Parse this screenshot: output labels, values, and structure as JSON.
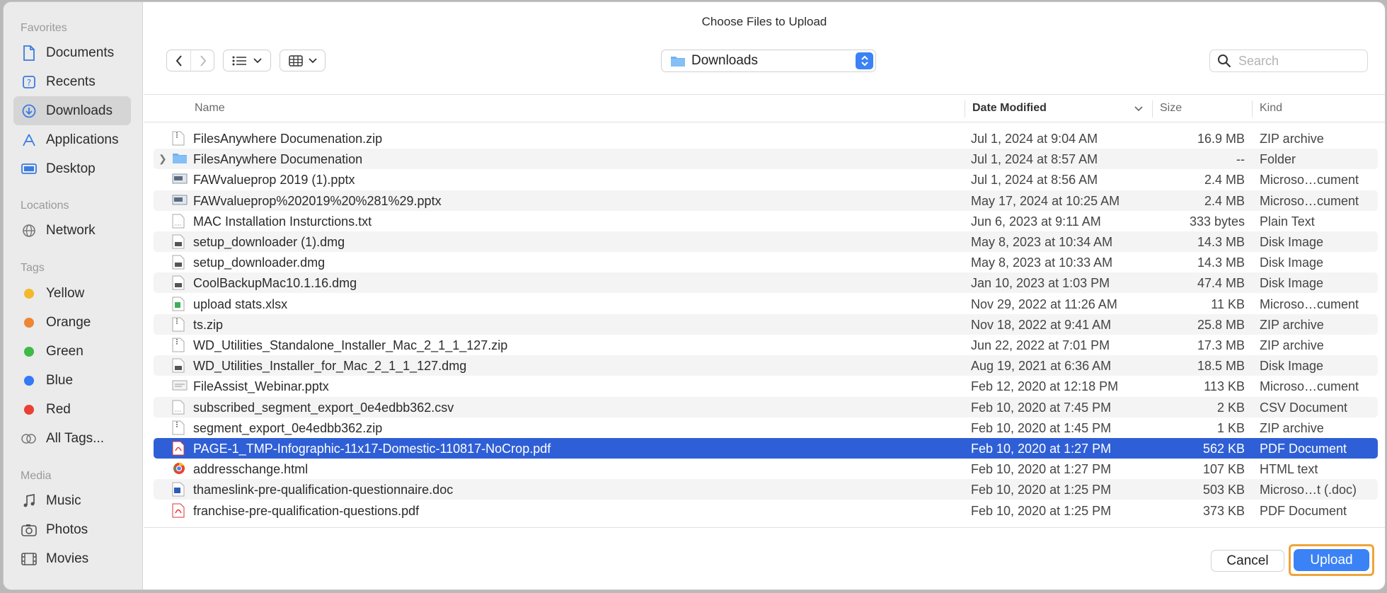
{
  "dialog": {
    "title": "Choose Files to Upload"
  },
  "sidebar": {
    "favorites_label": "Favorites",
    "favorites": [
      {
        "label": "Documents",
        "icon": "document-icon"
      },
      {
        "label": "Recents",
        "icon": "recents-icon"
      },
      {
        "label": "Downloads",
        "icon": "downloads-icon",
        "active": true
      },
      {
        "label": "Applications",
        "icon": "applications-icon"
      },
      {
        "label": "Desktop",
        "icon": "desktop-icon"
      }
    ],
    "locations_label": "Locations",
    "locations": [
      {
        "label": "Network",
        "icon": "network-icon"
      }
    ],
    "tags_label": "Tags",
    "tags": [
      {
        "label": "Yellow",
        "color": "#f2b92c"
      },
      {
        "label": "Orange",
        "color": "#ef8633"
      },
      {
        "label": "Green",
        "color": "#3fba46"
      },
      {
        "label": "Blue",
        "color": "#3479f6"
      },
      {
        "label": "Red",
        "color": "#ea4034"
      },
      {
        "label": "All Tags...",
        "icon": "all-tags-icon"
      }
    ],
    "media_label": "Media",
    "media": [
      {
        "label": "Music",
        "icon": "music-icon"
      },
      {
        "label": "Photos",
        "icon": "photos-icon"
      },
      {
        "label": "Movies",
        "icon": "movies-icon"
      }
    ]
  },
  "toolbar": {
    "location": "Downloads",
    "search_placeholder": "Search"
  },
  "columns": {
    "name": "Name",
    "date": "Date Modified",
    "size": "Size",
    "kind": "Kind"
  },
  "files": [
    {
      "name": "FilesAnywhere Documenation.zip",
      "date": "Jul 1, 2024 at 9:04 AM",
      "size": "16.9 MB",
      "kind": "ZIP archive",
      "type": "zip"
    },
    {
      "name": "FilesAnywhere Documenation",
      "date": "Jul 1, 2024 at 8:57 AM",
      "size": "--",
      "kind": "Folder",
      "type": "folder"
    },
    {
      "name": "FAWvalueprop 2019 (1).pptx",
      "date": "Jul 1, 2024 at 8:56 AM",
      "size": "2.4 MB",
      "kind": "Microso…cument",
      "type": "pptx"
    },
    {
      "name": "FAWvalueprop%202019%20%281%29.pptx",
      "date": "May 17, 2024 at 10:25 AM",
      "size": "2.4 MB",
      "kind": "Microso…cument",
      "type": "pptx"
    },
    {
      "name": "MAC Installation Insturctions.txt",
      "date": "Jun 6, 2023 at 9:11 AM",
      "size": "333 bytes",
      "kind": "Plain Text",
      "type": "txt"
    },
    {
      "name": "setup_downloader (1).dmg",
      "date": "May 8, 2023 at 10:34 AM",
      "size": "14.3 MB",
      "kind": "Disk Image",
      "type": "dmg"
    },
    {
      "name": "setup_downloader.dmg",
      "date": "May 8, 2023 at 10:33 AM",
      "size": "14.3 MB",
      "kind": "Disk Image",
      "type": "dmg"
    },
    {
      "name": "CoolBackupMac10.1.16.dmg",
      "date": "Jan 10, 2023 at 1:03 PM",
      "size": "47.4 MB",
      "kind": "Disk Image",
      "type": "dmg"
    },
    {
      "name": "upload stats.xlsx",
      "date": "Nov 29, 2022 at 11:26 AM",
      "size": "11 KB",
      "kind": "Microso…cument",
      "type": "xlsx"
    },
    {
      "name": "ts.zip",
      "date": "Nov 18, 2022 at 9:41 AM",
      "size": "25.8 MB",
      "kind": "ZIP archive",
      "type": "zip"
    },
    {
      "name": "WD_Utilities_Standalone_Installer_Mac_2_1_1_127.zip",
      "date": "Jun 22, 2022 at 7:01 PM",
      "size": "17.3 MB",
      "kind": "ZIP archive",
      "type": "zip"
    },
    {
      "name": "WD_Utilities_Installer_for_Mac_2_1_1_127.dmg",
      "date": "Aug 19, 2021 at 6:36 AM",
      "size": "18.5 MB",
      "kind": "Disk Image",
      "type": "dmg"
    },
    {
      "name": "FileAssist_Webinar.pptx",
      "date": "Feb 12, 2020 at 12:18 PM",
      "size": "113 KB",
      "kind": "Microso…cument",
      "type": "pptx2"
    },
    {
      "name": "subscribed_segment_export_0e4edbb362.csv",
      "date": "Feb 10, 2020 at 7:45 PM",
      "size": "2 KB",
      "kind": "CSV Document",
      "type": "txt"
    },
    {
      "name": "segment_export_0e4edbb362.zip",
      "date": "Feb 10, 2020 at 1:45 PM",
      "size": "1 KB",
      "kind": "ZIP archive",
      "type": "zip"
    },
    {
      "name": "PAGE-1_TMP-Infographic-11x17-Domestic-110817-NoCrop.pdf",
      "date": "Feb 10, 2020 at 1:27 PM",
      "size": "562 KB",
      "kind": "PDF Document",
      "type": "pdf",
      "selected": true
    },
    {
      "name": "addresschange.html",
      "date": "Feb 10, 2020 at 1:27 PM",
      "size": "107 KB",
      "kind": "HTML text",
      "type": "html"
    },
    {
      "name": "thameslink-pre-qualification-questionnaire.doc",
      "date": "Feb 10, 2020 at 1:25 PM",
      "size": "503 KB",
      "kind": "Microso…t (.doc)",
      "type": "doc"
    },
    {
      "name": "franchise-pre-qualification-questions.pdf",
      "date": "Feb 10, 2020 at 1:25 PM",
      "size": "373 KB",
      "kind": "PDF Document",
      "type": "pdf"
    }
  ],
  "footer": {
    "cancel_label": "Cancel",
    "upload_label": "Upload"
  },
  "colors": {
    "selection": "#2f5fd6",
    "accent": "#3a82f6",
    "focus_ring": "#f0a43a"
  }
}
